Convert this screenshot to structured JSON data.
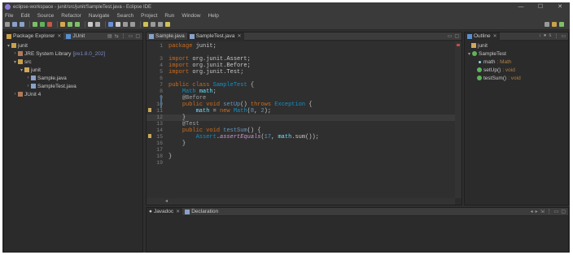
{
  "window": {
    "title": "eclipse-workspace - junit/src/junit/SampleTest.java - Eclipse IDE",
    "minimize": "—",
    "maximize": "☐",
    "close": "✕"
  },
  "menu": [
    "File",
    "Edit",
    "Source",
    "Refactor",
    "Navigate",
    "Search",
    "Project",
    "Run",
    "Window",
    "Help"
  ],
  "package_explorer": {
    "tabs": [
      {
        "label": "Package Explorer",
        "close": "✕"
      },
      {
        "label": "JUnit"
      }
    ],
    "tree": [
      {
        "arrow": "▾",
        "icon": "project",
        "label": "junit",
        "extra": ""
      },
      {
        "arrow": "›",
        "icon": "library",
        "label": "JRE System Library",
        "extra": "[jre1.8.0_202]"
      },
      {
        "arrow": "▾",
        "icon": "src-folder",
        "label": "src",
        "extra": ""
      },
      {
        "arrow": "▾",
        "icon": "package",
        "label": "junit",
        "extra": ""
      },
      {
        "arrow": "›",
        "icon": "java-file",
        "label": "Sample.java",
        "extra": ""
      },
      {
        "arrow": "›",
        "icon": "java-file",
        "label": "SampleTest.java",
        "extra": ""
      },
      {
        "arrow": "›",
        "icon": "library",
        "label": "JUnit 4",
        "extra": ""
      }
    ]
  },
  "editor": {
    "tabs": [
      {
        "label": "Sample.java"
      },
      {
        "label": "SampleTest.java",
        "close": "✕"
      }
    ],
    "line_numbers": [
      "1",
      "3",
      "4",
      "5",
      "6",
      "7",
      "8",
      "9",
      "10",
      "11",
      "12",
      "13",
      "14",
      "15",
      "16",
      "17",
      "18",
      "19"
    ],
    "lines": {
      "l1_kw": "package",
      "l1_rest": " junit;",
      "l3_kw": "import",
      "l3_rest": " org.junit.Assert;",
      "l4_kw": "import",
      "l4_rest": " org.junit.Before;",
      "l5_kw": "import",
      "l5_rest": " org.junit.Test;",
      "l7_kw1": "public",
      "l7_kw2": " class",
      "l7_ty": " SampleTest",
      "l7_rest": " {",
      "l8_ty": "Math",
      "l8_fld": " math",
      "l8_rest": ";",
      "l9_an": "@Before",
      "l10_kw1": "public",
      "l10_kw2": " void",
      "l10_nm": " setUp",
      "l10_a": "() ",
      "l10_kw3": "throws",
      "l10_ty": " Exception",
      "l10_rest": " {",
      "l11_fld": "math",
      "l11_a": " = ",
      "l11_kw": "new",
      "l11_ty": " Math",
      "l11_b": "(",
      "l11_n1": "8",
      "l11_c": ", ",
      "l11_n2": "2",
      "l11_d": ");",
      "l12": "}",
      "l13_an": "@Test",
      "l14_kw1": "public",
      "l14_kw2": " void",
      "l14_nm": " testSum",
      "l14_rest": "() {",
      "l15_ty": "Assert",
      "l15_a": ".",
      "l15_sm": "assertEquals",
      "l15_b": "(",
      "l15_n": "17",
      "l15_c": ", ",
      "l15_fld": "math",
      "l15_d": ".sum());",
      "l16": "}",
      "l18": "}"
    }
  },
  "outline": {
    "tabs": [
      {
        "label": "Outline",
        "close": "✕"
      }
    ],
    "items": [
      {
        "icon": "package",
        "label": "junit",
        "extra": ""
      },
      {
        "icon": "class",
        "label": "SampleTest",
        "extra": ""
      },
      {
        "icon": "field",
        "label": "math",
        "extra": ": Math"
      },
      {
        "icon": "method",
        "label": "setUp()",
        "extra": ": void"
      },
      {
        "icon": "method",
        "label": "testSum()",
        "extra": ": void"
      }
    ]
  },
  "bottom": {
    "tabs": [
      {
        "label": "Javadoc",
        "close": "✕"
      },
      {
        "label": "Declaration"
      }
    ]
  },
  "colors": {
    "background": "#2f2f2f",
    "keyword": "#cc6c1d",
    "type": "#1290c3",
    "field": "#66e1f8",
    "number": "#6897bb"
  }
}
